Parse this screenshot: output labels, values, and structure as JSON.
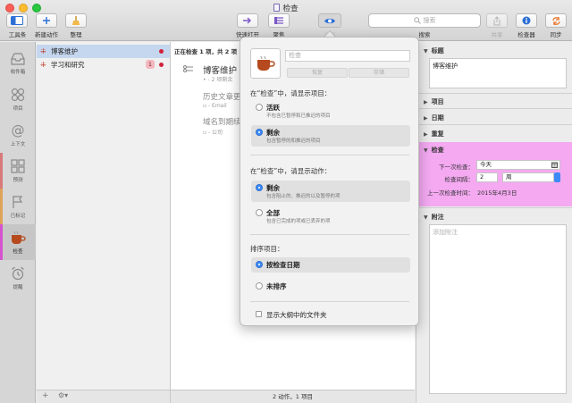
{
  "window": {
    "title": "检查"
  },
  "toolbar": {
    "sidebar_label": "工具条",
    "new_label": "新建动作",
    "cleanup_label": "整理",
    "quickopen_label": "快速打开",
    "focus_label": "聚焦",
    "view_label": "视图",
    "search_placeholder": "搜索",
    "search_label": "搜索",
    "share_label": "共享",
    "inspector_label": "检查器",
    "sync_label": "同步"
  },
  "rail": {
    "items": [
      {
        "label": "收件箱",
        "icon": "inbox-icon"
      },
      {
        "label": "项目",
        "icon": "projects-icon"
      },
      {
        "label": "上下文",
        "icon": "contexts-icon"
      },
      {
        "label": "预测",
        "icon": "forecast-icon"
      },
      {
        "label": "已标记",
        "icon": "flag-icon"
      },
      {
        "label": "检查",
        "icon": "review-icon"
      },
      {
        "label": "提醒",
        "icon": "alarm-icon"
      }
    ]
  },
  "sidebar": {
    "items": [
      {
        "label": "博客维护",
        "badge": ""
      },
      {
        "label": "学习和研究",
        "badge": "1"
      }
    ]
  },
  "main": {
    "header": "正在检查 1 项，共 2 项",
    "rows": [
      {
        "title": "博客维护",
        "meta": "• - 2 项剩余"
      },
      {
        "title": "历史文章更",
        "meta": "▫ - Email"
      },
      {
        "title": "域名到期续",
        "meta": "▫ - 公司"
      }
    ],
    "footer": "2 动作，1 项目"
  },
  "popover": {
    "name_placeholder": "检查",
    "restore_label": "恢复",
    "save_label": "存储",
    "section1": "在“检查”中，请显示项目：",
    "projects": [
      {
        "title": "活跃",
        "sub": "不包含已暂停和已推迟的项目",
        "selected": false
      },
      {
        "title": "剩余",
        "sub": "包含暂停的和推迟的项目",
        "selected": true
      }
    ],
    "section2": "在“检查”中，请显示动作：",
    "actions": [
      {
        "title": "剩余",
        "sub": "包含阻止的、推迟的以及暂停的项",
        "selected": true
      },
      {
        "title": "全部",
        "sub": "包含已完成的项或已丢弃的项",
        "selected": false
      }
    ],
    "section3": "排序项目：",
    "sorts": [
      {
        "title": "按检查日期",
        "selected": true
      },
      {
        "title": "未排序",
        "selected": false
      }
    ],
    "show_folders": "显示大纲中的文件夹"
  },
  "inspector": {
    "title_head": "标题",
    "title_value": "博客维护",
    "project_head": "项目",
    "dates_head": "日期",
    "repeat_head": "重复",
    "review_head": "检查",
    "next_review_label": "下一次检查：",
    "next_review_value": "今天",
    "interval_label": "检查间隔：",
    "interval_value": "2",
    "interval_unit": "周",
    "last_review_label": "上一次检查时间：",
    "last_review_value": "2015年4月3日",
    "note_head": "附注",
    "note_placeholder": "添加附注"
  },
  "colors": {
    "review_highlight": "#f4a9f1",
    "selection": "#c5d7ef",
    "accent": "#3d8af7",
    "badge": "#f3b8c0",
    "flag_dot": "#d0243a"
  }
}
